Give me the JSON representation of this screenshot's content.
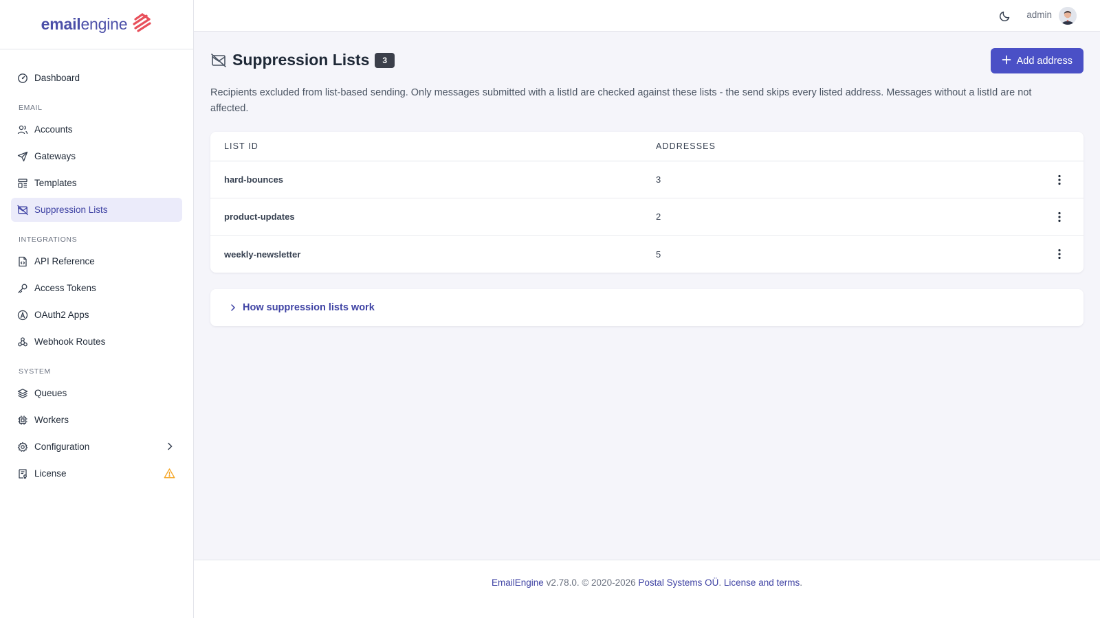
{
  "brand": {
    "name_bold": "email",
    "name_rest": "engine"
  },
  "sidebar": {
    "dashboard": {
      "label": "Dashboard",
      "icon": "dashboard-icon"
    },
    "sections": {
      "email": "EMAIL",
      "integrations": "INTEGRATIONS",
      "system": "SYSTEM"
    },
    "email_items": [
      {
        "label": "Accounts",
        "icon": "users-icon"
      },
      {
        "label": "Gateways",
        "icon": "send-icon"
      },
      {
        "label": "Templates",
        "icon": "template-icon"
      },
      {
        "label": "Suppression Lists",
        "icon": "mail-off-icon",
        "active": true
      }
    ],
    "integration_items": [
      {
        "label": "API Reference",
        "icon": "file-code-icon"
      },
      {
        "label": "Access Tokens",
        "icon": "key-icon"
      },
      {
        "label": "OAuth2 Apps",
        "icon": "oauth-icon"
      },
      {
        "label": "Webhook Routes",
        "icon": "webhook-icon"
      }
    ],
    "system_items": [
      {
        "label": "Queues",
        "icon": "stack-icon"
      },
      {
        "label": "Workers",
        "icon": "cpu-icon"
      },
      {
        "label": "Configuration",
        "icon": "gear-icon",
        "trailing": "chevron-right-icon"
      },
      {
        "label": "License",
        "icon": "license-icon",
        "trailing": "warning-icon"
      }
    ]
  },
  "topbar": {
    "username": "admin",
    "theme_icon": "moon-icon"
  },
  "page": {
    "title": "Suppression Lists",
    "count": "3",
    "add_button": "Add address",
    "description": "Recipients excluded from list-based sending. Only messages submitted with a listId are checked against these lists - the send skips every listed address. Messages without a listId are not affected."
  },
  "table": {
    "headers": {
      "list_id": "LIST ID",
      "addresses": "ADDRESSES"
    },
    "rows": [
      {
        "list_id": "hard-bounces",
        "addresses": "3"
      },
      {
        "list_id": "product-updates",
        "addresses": "2"
      },
      {
        "list_id": "weekly-newsletter",
        "addresses": "5"
      }
    ]
  },
  "help": {
    "title": "How suppression lists work"
  },
  "footer": {
    "product": "EmailEngine",
    "version_text": " v2.78.0. © 2020-2026 ",
    "company": "Postal Systems OÜ",
    "license": "License and terms",
    "dot1": ". ",
    "dot2": "."
  },
  "colors": {
    "accent": "#4a50c6",
    "active_bg": "#ebebfa",
    "badge": "#3b3f4a",
    "warning": "#f5a524",
    "logo": "#e8505b"
  }
}
